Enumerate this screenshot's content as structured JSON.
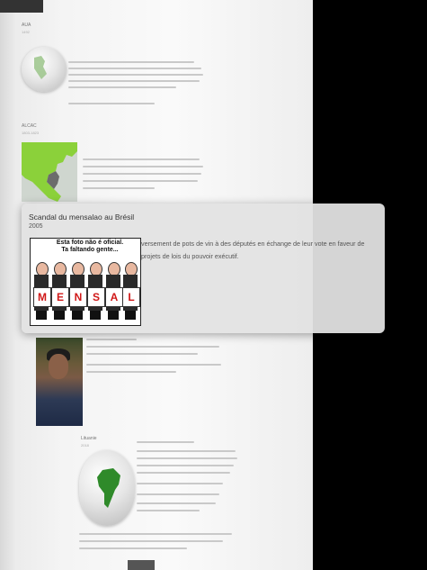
{
  "background_page": {
    "sections": [
      {
        "label": "AUA",
        "sub": "1492"
      },
      {
        "label": "ALCAC",
        "sub": "1803-1823"
      },
      {
        "label": "",
        "sub": "2005"
      },
      {
        "label": "Lituanie",
        "sub": "2018"
      }
    ]
  },
  "popup": {
    "title": "Scandal du mensalao au Brésil",
    "year": "2005",
    "description": "versement de pots de vin à des députés en échange de leur vote en faveur de projets de lois du pouvoir exécutif.",
    "image": {
      "caption_line1": "Esta foto não é oficial.",
      "caption_line2": "Ta faltando gente...",
      "letters": [
        "M",
        "E",
        "N",
        "S",
        "A",
        "L"
      ]
    }
  },
  "colors": {
    "page_bg": "#f4f4f4",
    "side_bg": "#000000",
    "popup_bg": "#e2e2e2",
    "map_green": "#8bd13a",
    "globe_green": "#2f8a2a",
    "sign_red": "#d01818"
  }
}
